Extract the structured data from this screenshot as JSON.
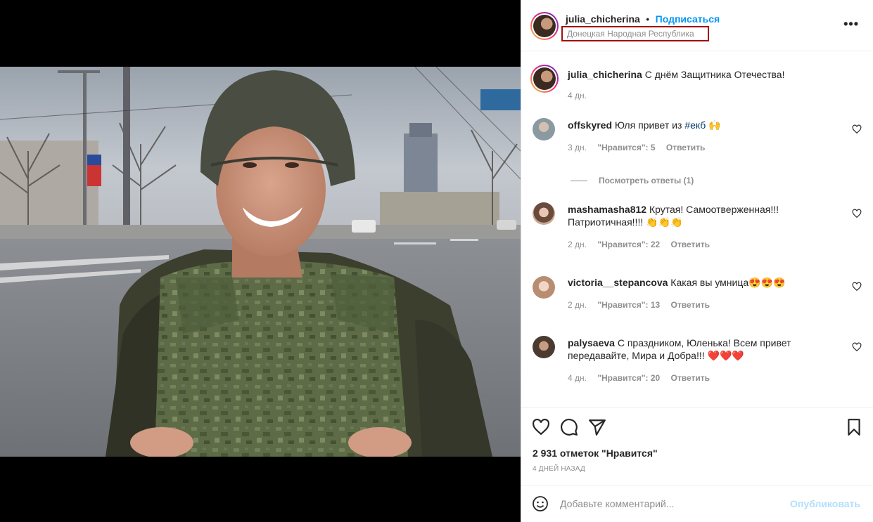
{
  "post": {
    "author": "julia_chicherina",
    "separator": "•",
    "follow_label": "Подписаться",
    "location": "Донецкая Народная Республика",
    "more_label": "•••",
    "caption": "С днём Защитника Отечества!",
    "caption_age": "4 дн.",
    "likes": "2 931 отметок \"Нравится\"",
    "date": "4 ДНЕЙ НАЗАД"
  },
  "comments": [
    {
      "user": "offskyred",
      "text_before": "Юля привет из ",
      "hashtag": "#екб",
      "text_after": " 🙌",
      "age": "3 дн.",
      "likes": "\"Нравится\": 5",
      "reply": "Ответить",
      "avatar_color": "#8a9aa0"
    },
    {
      "user": "mashamasha812",
      "text": "Крутая! Самоотверженная!!! Патриотичная!!!! 👏👏👏",
      "age": "2 дн.",
      "likes": "\"Нравится\": 22",
      "reply": "Ответить",
      "avatar_color": "#c9a892"
    },
    {
      "user": "victoria__stepancova",
      "text": "Какая вы умница😍😍😍",
      "age": "2 дн.",
      "likes": "\"Нравится\": 13",
      "reply": "Ответить",
      "avatar_color": "#d8b8a2"
    },
    {
      "user": "palysaeva",
      "text": "С праздником, Юленька! Всем привет передавайте, Мира и Добра!!! ❤️❤️❤️",
      "age": "4 дн.",
      "likes": "\"Нравится\": 20",
      "reply": "Ответить",
      "avatar_color": "#5c4a40"
    }
  ],
  "view_replies": "Посмотреть ответы (1)",
  "add_comment": {
    "placeholder": "Добавьте комментарий...",
    "publish_label": "Опубликовать"
  },
  "icons": {
    "like": "heart-icon",
    "comment": "comment-icon",
    "share": "send-icon",
    "save": "bookmark-icon",
    "emoji": "emoji-icon"
  },
  "colors": {
    "follow": "#0095f6",
    "publish_disabled": "#b2dffc",
    "location_highlight": "#a01010"
  }
}
